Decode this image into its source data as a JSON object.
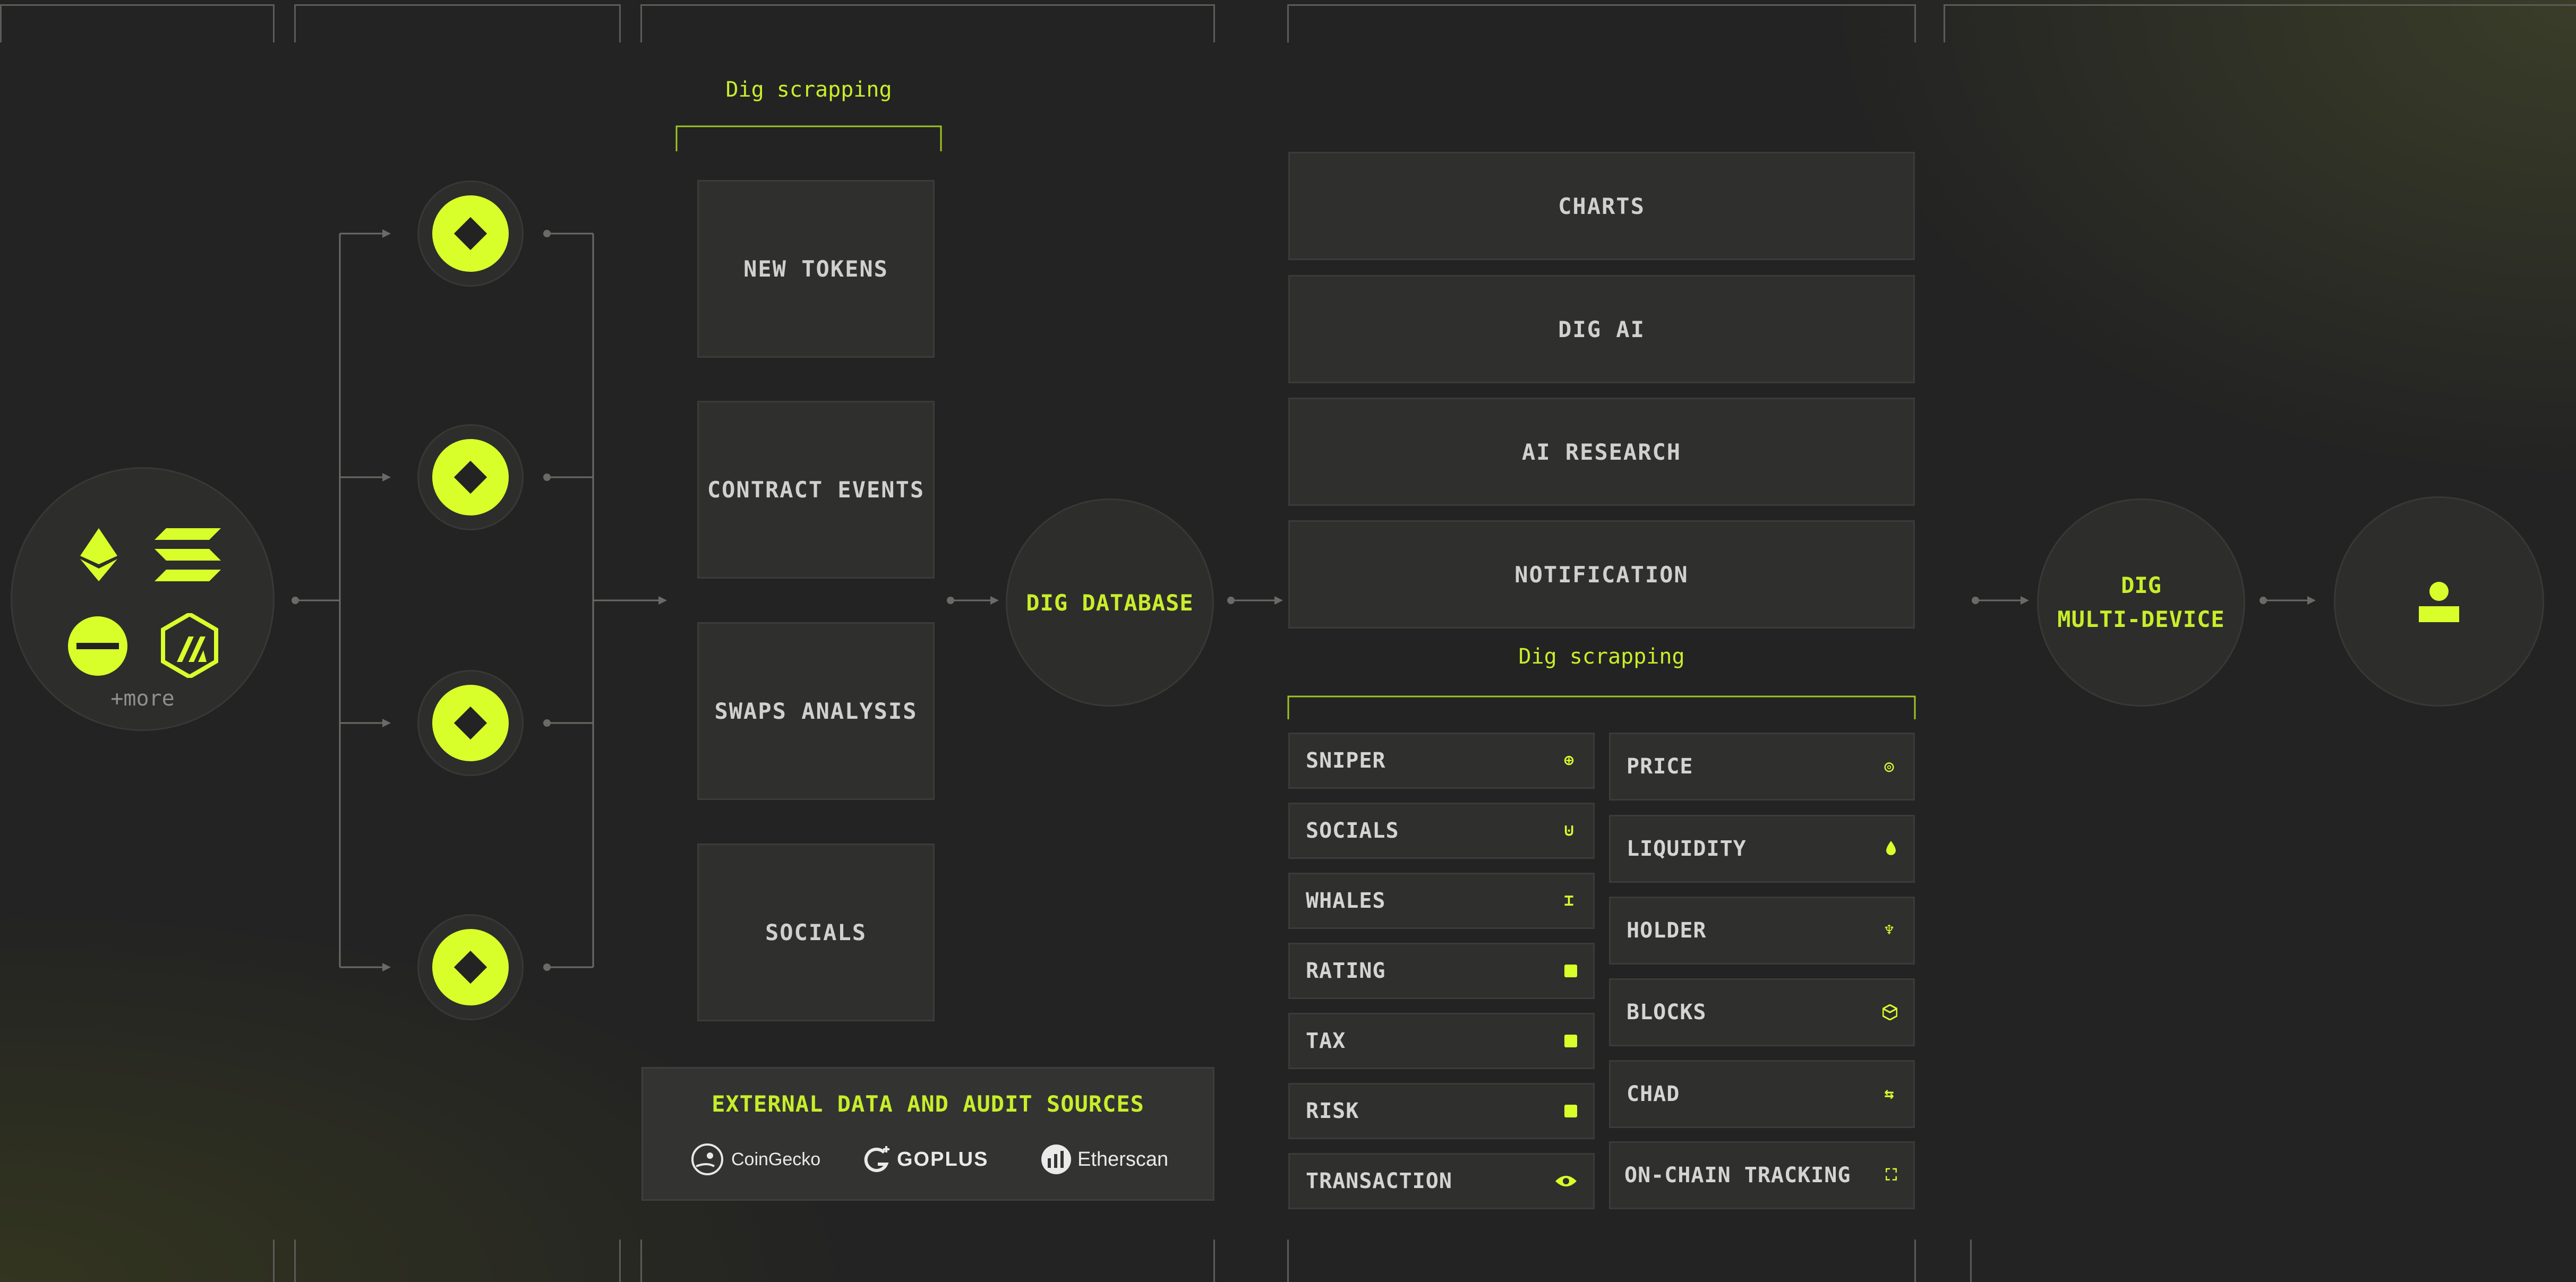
{
  "chains": {
    "more_label": "+more"
  },
  "scraper_top": {
    "label": "Dig scrapping"
  },
  "sources": [
    "NEW TOKENS",
    "CONTRACT EVENTS",
    "SWAPS ANALYSIS",
    "SOCIALS"
  ],
  "database": {
    "label": "DIG DATABASE"
  },
  "outputs": [
    "CHARTS",
    "DIG AI",
    "AI RESEARCH",
    "NOTIFICATION"
  ],
  "scraper_bottom": {
    "label": "Dig scrapping"
  },
  "features_left": [
    {
      "label": "SNIPER",
      "icon": "crosshair-icon"
    },
    {
      "label": "SOCIALS",
      "icon": "magnet-icon"
    },
    {
      "label": "WHALES",
      "icon": "whale-tail-icon"
    },
    {
      "label": "RATING",
      "icon": "rating-icon"
    },
    {
      "label": "TAX",
      "icon": "tax-icon"
    },
    {
      "label": "RISK",
      "icon": "risk-icon"
    },
    {
      "label": "TRANSACTION",
      "icon": "eye-icon"
    }
  ],
  "features_right": [
    {
      "label": "PRICE",
      "icon": "target-icon"
    },
    {
      "label": "LIQUIDITY",
      "icon": "drop-icon"
    },
    {
      "label": "HOLDER",
      "icon": "holder-icon"
    },
    {
      "label": "BLOCKS",
      "icon": "cube-icon"
    },
    {
      "label": "CHAD",
      "icon": "swap-icon"
    },
    {
      "label": "ON-CHAIN TRACKING",
      "icon": "scan-icon"
    }
  ],
  "external": {
    "title": "EXTERNAL DATA AND AUDIT SOURCES",
    "logos": [
      "CoinGecko",
      "GOPLUS",
      "Etherscan"
    ]
  },
  "multidevice": {
    "line1": "DIG",
    "line2": "MULTI-DEVICE"
  },
  "colors": {
    "accent": "#d9ff2b",
    "background": "#232323",
    "box": "#2f2f2e"
  }
}
